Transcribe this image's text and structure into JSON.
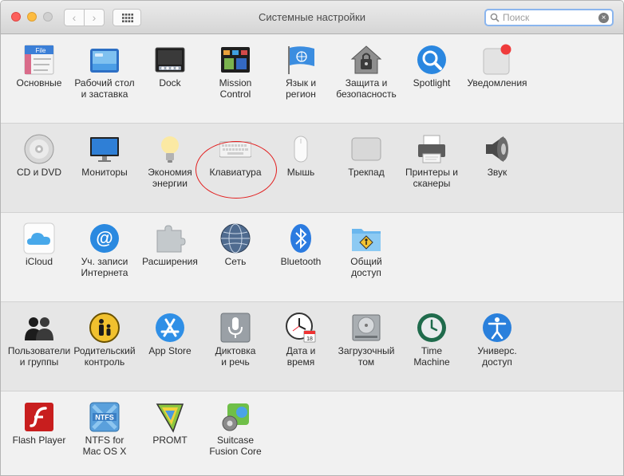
{
  "window": {
    "title": "Системные настройки"
  },
  "toolbar": {
    "back_glyph": "‹",
    "forward_glyph": "›"
  },
  "search": {
    "placeholder": "Поиск",
    "value": "",
    "clear_glyph": "×"
  },
  "rows": [
    {
      "panes": [
        {
          "id": "general",
          "label": "Основные",
          "icon": "general-icon"
        },
        {
          "id": "desktop",
          "label": "Рабочий стол\nи заставка",
          "icon": "desktop-icon"
        },
        {
          "id": "dock",
          "label": "Dock",
          "icon": "dock-icon"
        },
        {
          "id": "mission-control",
          "label": "Mission\nControl",
          "icon": "mission-control-icon"
        },
        {
          "id": "language",
          "label": "Язык и\nрегион",
          "icon": "flag-icon"
        },
        {
          "id": "security",
          "label": "Защита и\nбезопасность",
          "icon": "house-lock-icon"
        },
        {
          "id": "spotlight",
          "label": "Spotlight",
          "icon": "magnifier-icon"
        },
        {
          "id": "notifications",
          "label": "Уведомления",
          "icon": "notifications-icon"
        }
      ]
    },
    {
      "panes": [
        {
          "id": "cd-dvd",
          "label": "CD и DVD",
          "icon": "disc-icon"
        },
        {
          "id": "displays",
          "label": "Мониторы",
          "icon": "monitor-icon"
        },
        {
          "id": "energy",
          "label": "Экономия\nэнергии",
          "icon": "bulb-icon"
        },
        {
          "id": "keyboard",
          "label": "Клавиатура",
          "icon": "keyboard-icon"
        },
        {
          "id": "mouse",
          "label": "Мышь",
          "icon": "mouse-icon"
        },
        {
          "id": "trackpad",
          "label": "Трекпад",
          "icon": "trackpad-icon"
        },
        {
          "id": "printers",
          "label": "Принтеры и\nсканеры",
          "icon": "printer-icon"
        },
        {
          "id": "sound",
          "label": "Звук",
          "icon": "speaker-icon"
        }
      ]
    },
    {
      "panes": [
        {
          "id": "icloud",
          "label": "iCloud",
          "icon": "cloud-icon"
        },
        {
          "id": "internet-accounts",
          "label": "Уч. записи\nИнтернета",
          "icon": "at-sign-icon"
        },
        {
          "id": "extensions",
          "label": "Расширения",
          "icon": "puzzle-icon"
        },
        {
          "id": "network",
          "label": "Сеть",
          "icon": "globe-icon"
        },
        {
          "id": "bluetooth",
          "label": "Bluetooth",
          "icon": "bluetooth-icon"
        },
        {
          "id": "sharing",
          "label": "Общий\nдоступ",
          "icon": "shared-folder-icon"
        }
      ]
    },
    {
      "panes": [
        {
          "id": "users",
          "label": "Пользователи\nи группы",
          "icon": "users-icon"
        },
        {
          "id": "parental",
          "label": "Родительский\nконтроль",
          "icon": "parental-icon"
        },
        {
          "id": "app-store",
          "label": "App Store",
          "icon": "app-store-icon"
        },
        {
          "id": "dictation",
          "label": "Диктовка\nи речь",
          "icon": "microphone-icon"
        },
        {
          "id": "date-time",
          "label": "Дата и\nвремя",
          "icon": "clock-calendar-icon"
        },
        {
          "id": "startup-disk",
          "label": "Загрузочный\nтом",
          "icon": "hard-drive-icon"
        },
        {
          "id": "time-machine",
          "label": "Time\nMachine",
          "icon": "time-machine-icon"
        },
        {
          "id": "accessibility",
          "label": "Универс.\nдоступ",
          "icon": "accessibility-icon"
        }
      ]
    },
    {
      "panes": [
        {
          "id": "flash",
          "label": "Flash Player",
          "icon": "flash-icon"
        },
        {
          "id": "ntfs",
          "label": "NTFS for\nMac OS X",
          "icon": "ntfs-icon"
        },
        {
          "id": "promt",
          "label": "PROMT",
          "icon": "promt-icon"
        },
        {
          "id": "suitcase",
          "label": "Suitcase\nFusion Core",
          "icon": "suitcase-icon"
        }
      ]
    }
  ],
  "icon_texts": {
    "general_file": "File",
    "ntfs": "NTFS",
    "calendar_day": "18"
  },
  "colors": {
    "annotation": "#e21b1b",
    "search_focus": "#8ab5ee"
  }
}
